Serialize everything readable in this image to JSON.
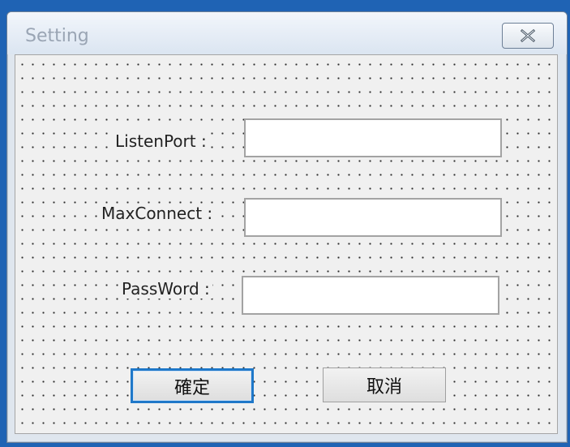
{
  "window": {
    "title": "Setting",
    "close_icon": "close-icon"
  },
  "form": {
    "listen_port_label": "ListenPort :",
    "max_connect_label": "MaxConnect :",
    "password_label": "PassWord :",
    "listen_port_value": "",
    "max_connect_value": "",
    "password_value": ""
  },
  "buttons": {
    "ok_label": "確定",
    "cancel_label": "取消"
  },
  "colors": {
    "desktop": "#1f63b4",
    "focus": "#1f78c9"
  }
}
